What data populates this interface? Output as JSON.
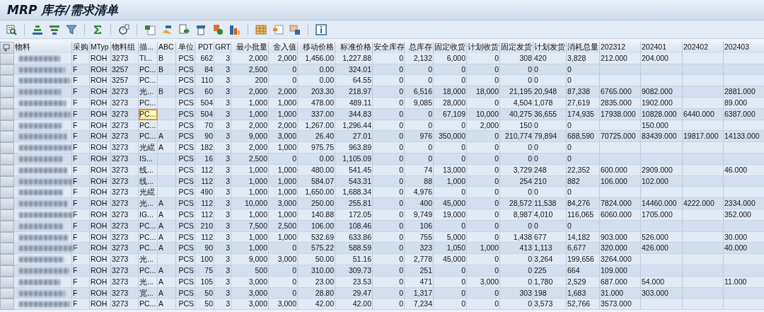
{
  "window": {
    "title": "MRP 库存/需求清单"
  },
  "table": {
    "columns": [
      "物料",
      "采购",
      "MTyp",
      "物料组",
      "描...",
      "ABC",
      "单位",
      "PDT",
      "GRT",
      "最小批量",
      "舍入值",
      "移动价格",
      "标准价格",
      "安全库存",
      "总库存",
      "固定收货",
      "计划收货",
      "固定发货",
      "计划发货",
      "消耗总量",
      "202312",
      "202401",
      "202402",
      "202403"
    ],
    "rows": [
      {
        "desc_focused": false,
        "cells": [
          "",
          "F",
          "ROH",
          "3273",
          "TI...",
          "B",
          "PCS",
          "662",
          "3",
          "2,000",
          "2,000",
          "1,456.00",
          "1,227.88",
          "0",
          "2,132",
          "6,000",
          "0",
          "308",
          "420",
          "3,828",
          "212.000",
          "204.000",
          "",
          ""
        ]
      },
      {
        "desc_focused": false,
        "cells": [
          "",
          "F",
          "ROH",
          "3257",
          "PC...",
          "B",
          "PCS",
          "84",
          "3",
          "2,500",
          "0",
          "0.00",
          "324.01",
          "0",
          "0",
          "0",
          "0",
          "0",
          "0",
          "0",
          "",
          "",
          "",
          ""
        ]
      },
      {
        "desc_focused": false,
        "cells": [
          "",
          "F",
          "ROH",
          "3257",
          "PC...",
          "",
          "PCS",
          "110",
          "3",
          "200",
          "0",
          "0.00",
          "64.55",
          "0",
          "0",
          "0",
          "0",
          "0",
          "0",
          "0",
          "",
          "",
          "",
          ""
        ]
      },
      {
        "desc_focused": false,
        "cells": [
          "",
          "F",
          "ROH",
          "3273",
          "光...",
          "B",
          "PCS",
          "60",
          "3",
          "2,000",
          "2,000",
          "203.30",
          "218.97",
          "0",
          "6,516",
          "18,000",
          "18,000",
          "21,195",
          "20,948",
          "87,338",
          "6765.000",
          "9082.000",
          "",
          "2881.000"
        ]
      },
      {
        "desc_focused": false,
        "cells": [
          "",
          "F",
          "ROH",
          "3273",
          "PC...",
          "",
          "PCS",
          "504",
          "3",
          "1,000",
          "1,000",
          "478.00",
          "489.11",
          "0",
          "9,085",
          "28,000",
          "0",
          "4,504",
          "1,078",
          "27,619",
          "2835.000",
          "1902.000",
          "",
          "89.000"
        ]
      },
      {
        "desc_focused": true,
        "cells": [
          "",
          "F",
          "ROH",
          "3273",
          "PC...",
          "",
          "PCS",
          "504",
          "3",
          "1,000",
          "1,000",
          "337.00",
          "344.83",
          "0",
          "0",
          "67,109",
          "10,000",
          "40,275",
          "36,655",
          "174,935",
          "17938.000",
          "10828.000",
          "6440.000",
          "6387.000"
        ]
      },
      {
        "desc_focused": false,
        "cells": [
          "",
          "F",
          "ROH",
          "3273",
          "PC...",
          "",
          "PCS",
          "70",
          "3",
          "2,000",
          "2,000",
          "1,267.00",
          "1,296.44",
          "0",
          "0",
          "0",
          "2,000",
          "150",
          "0",
          "0",
          "",
          "150.000",
          "",
          ""
        ]
      },
      {
        "desc_focused": false,
        "cells": [
          "",
          "F",
          "ROH",
          "3273",
          "PC...",
          "A",
          "PCS",
          "90",
          "3",
          "9,000",
          "3,000",
          "26.40",
          "27.01",
          "0",
          "976",
          "350,000",
          "0",
          "210,774",
          "79,894",
          "688,590",
          "70725.000",
          "83439.000",
          "19817.000",
          "14133.000"
        ]
      },
      {
        "desc_focused": false,
        "cells": [
          "",
          "F",
          "ROH",
          "3273",
          "光緄",
          "A",
          "PCS",
          "182",
          "3",
          "2,000",
          "1,000",
          "975.75",
          "963.89",
          "0",
          "0",
          "0",
          "0",
          "0",
          "0",
          "0",
          "",
          "",
          "",
          ""
        ]
      },
      {
        "desc_focused": false,
        "cells": [
          "",
          "F",
          "ROH",
          "3273",
          "IS...",
          "",
          "PCS",
          "16",
          "3",
          "2,500",
          "0",
          "0.00",
          "1,105.09",
          "0",
          "0",
          "0",
          "0",
          "0",
          "0",
          "0",
          "",
          "",
          "",
          ""
        ]
      },
      {
        "desc_focused": false,
        "cells": [
          "",
          "F",
          "ROH",
          "3273",
          "线...",
          "",
          "PCS",
          "112",
          "3",
          "1,000",
          "1,000",
          "480.00",
          "541.45",
          "0",
          "74",
          "13,000",
          "0",
          "3,729",
          "248",
          "22,352",
          "600.000",
          "2909.000",
          "",
          "46.000"
        ]
      },
      {
        "desc_focused": false,
        "cells": [
          "",
          "F",
          "ROH",
          "3273",
          "线...",
          "",
          "PCS",
          "112",
          "3",
          "1,000",
          "1,000",
          "584.07",
          "543.31",
          "0",
          "88",
          "1,000",
          "0",
          "254",
          "210",
          "882",
          "106.000",
          "102.000",
          "",
          ""
        ]
      },
      {
        "desc_focused": false,
        "cells": [
          "",
          "F",
          "ROH",
          "3273",
          "光緄",
          "",
          "PCS",
          "490",
          "3",
          "1,000",
          "1,000",
          "1,650.00",
          "1,688.34",
          "0",
          "4,976",
          "0",
          "0",
          "0",
          "0",
          "0",
          "",
          "",
          "",
          ""
        ]
      },
      {
        "desc_focused": false,
        "cells": [
          "",
          "F",
          "ROH",
          "3273",
          "光...",
          "A",
          "PCS",
          "112",
          "3",
          "10,000",
          "3,000",
          "250.00",
          "255.81",
          "0",
          "400",
          "45,000",
          "0",
          "28,572",
          "11,538",
          "84,276",
          "7824.000",
          "14460.000",
          "4222.000",
          "2334.000"
        ]
      },
      {
        "desc_focused": false,
        "cells": [
          "",
          "F",
          "ROH",
          "3273",
          "IG...",
          "A",
          "PCS",
          "112",
          "3",
          "1,000",
          "1,000",
          "140.88",
          "172.05",
          "0",
          "9,749",
          "19,000",
          "0",
          "8,987",
          "4,010",
          "116,065",
          "6060.000",
          "1705.000",
          "",
          "352.000"
        ]
      },
      {
        "desc_focused": false,
        "cells": [
          "",
          "F",
          "ROH",
          "3273",
          "PC...",
          "A",
          "PCS",
          "210",
          "3",
          "7,500",
          "2,500",
          "106.00",
          "108.46",
          "0",
          "106",
          "0",
          "0",
          "0",
          "0",
          "0",
          "",
          "",
          "",
          ""
        ]
      },
      {
        "desc_focused": false,
        "cells": [
          "",
          "F",
          "ROH",
          "3273",
          "PC...",
          "A",
          "PCS",
          "112",
          "3",
          "1,000",
          "1,000",
          "532.69",
          "633.86",
          "0",
          "755",
          "5,000",
          "0",
          "1,438",
          "677",
          "14,182",
          "903.000",
          "526.000",
          "",
          "30.000"
        ]
      },
      {
        "desc_focused": false,
        "cells": [
          "",
          "F",
          "ROH",
          "3273",
          "PC...",
          "A",
          "PCS",
          "90",
          "3",
          "1,000",
          "0",
          "575.22",
          "588.59",
          "0",
          "323",
          "1,050",
          "1,000",
          "413",
          "1,113",
          "6,677",
          "320.000",
          "426.000",
          "",
          "40.000"
        ]
      },
      {
        "desc_focused": false,
        "cells": [
          "",
          "F",
          "ROH",
          "3273",
          "光...",
          "",
          "PCS",
          "100",
          "3",
          "9,000",
          "3,000",
          "50.00",
          "51.16",
          "0",
          "2,778",
          "45,000",
          "0",
          "0",
          "3,264",
          "199,656",
          "3264.000",
          "",
          "",
          ""
        ]
      },
      {
        "desc_focused": false,
        "cells": [
          "",
          "F",
          "ROH",
          "3273",
          "PC...",
          "A",
          "PCS",
          "75",
          "3",
          "500",
          "0",
          "310.00",
          "309.73",
          "0",
          "251",
          "0",
          "0",
          "0",
          "225",
          "664",
          "109.000",
          "",
          "",
          ""
        ]
      },
      {
        "desc_focused": false,
        "cells": [
          "",
          "F",
          "ROH",
          "3273",
          "光...",
          "A",
          "PCS",
          "105",
          "3",
          "3,000",
          "0",
          "23.00",
          "23.53",
          "0",
          "471",
          "0",
          "3,000",
          "0",
          "1,780",
          "2,529",
          "687.000",
          "54.000",
          "",
          "11.000"
        ]
      },
      {
        "desc_focused": false,
        "cells": [
          "",
          "F",
          "ROH",
          "3273",
          "宽...",
          "A",
          "PCS",
          "50",
          "3",
          "3,000",
          "0",
          "28.80",
          "29.47",
          "0",
          "1,317",
          "0",
          "0",
          "303",
          "198",
          "1,683",
          "31.000",
          "303.000",
          "",
          ""
        ]
      },
      {
        "desc_focused": false,
        "cells": [
          "",
          "F",
          "ROH",
          "3273",
          "PC...",
          "A",
          "PCS",
          "50",
          "3",
          "3,000",
          "3,000",
          "42.00",
          "42.00",
          "0",
          "7,234",
          "0",
          "0",
          "0",
          "3,573",
          "52,766",
          "3573.000",
          "",
          "",
          ""
        ]
      }
    ]
  }
}
